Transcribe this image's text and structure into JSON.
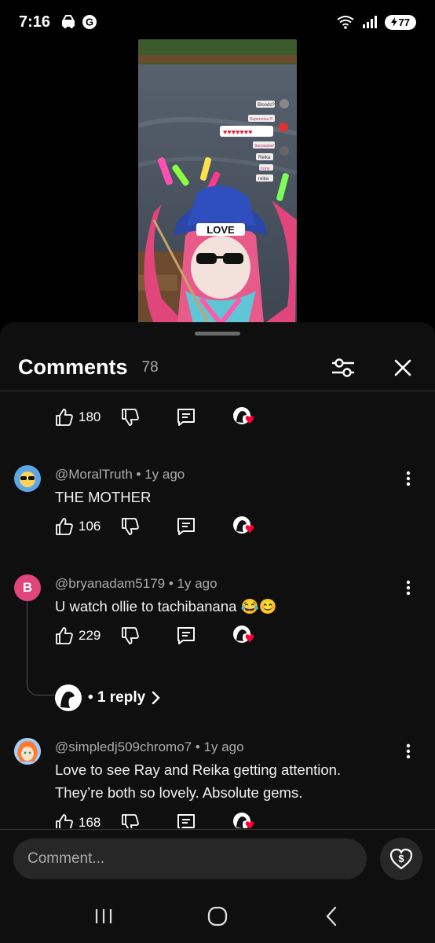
{
  "status_bar": {
    "time": "7:16",
    "battery": "77",
    "signal_label": "5"
  },
  "sheet": {
    "title": "Comments",
    "count": "78"
  },
  "top_actions": {
    "likes": "180"
  },
  "comments": [
    {
      "author": "@MoralTruth",
      "age": "1y ago",
      "text": "THE MOTHER",
      "likes": "106",
      "avatar_color": "#4a90d9"
    },
    {
      "author": "@bryanadam5179",
      "age": "1y ago",
      "text": "U watch ollie to tachibanana 😂😊",
      "likes": "229",
      "avatar_letter": "B",
      "avatar_color": "#e0457b",
      "replies_label": "1 reply"
    },
    {
      "author": "@simpledj509chromo7",
      "age": "1y ago",
      "text": "Love to see Ray and Reika getting attention. They’re both so lovely. Absolute gems.",
      "likes": "168"
    }
  ],
  "input": {
    "placeholder": "Comment..."
  },
  "video": {
    "chat_labels": [
      "Bloodo?",
      "Supernova !!!",
      "♥♥♥♥♥♥♥",
      "Suryaspeel",
      "Reika",
      "Irono",
      "reika"
    ],
    "hat_text": "LOVE"
  },
  "colors": {
    "sheet_bg": "#0f0f0f",
    "accent_red": "#ff0033"
  }
}
